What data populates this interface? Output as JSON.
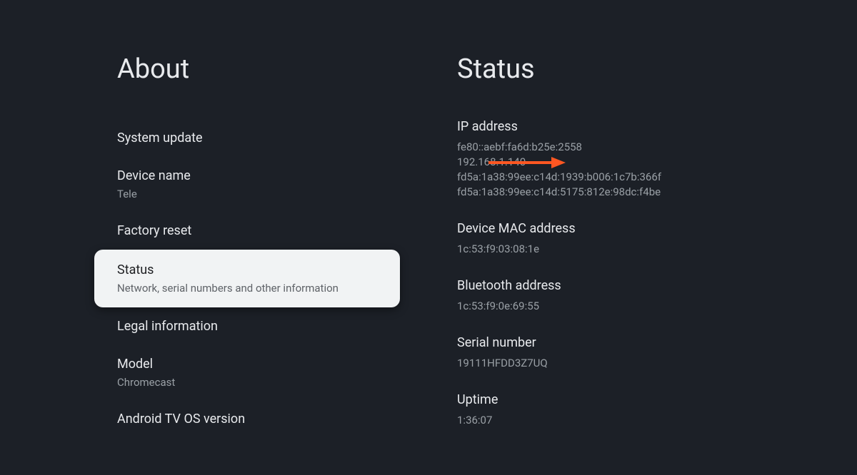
{
  "left": {
    "title": "About",
    "items": [
      {
        "title": "System update",
        "subtitle": ""
      },
      {
        "title": "Device name",
        "subtitle": "Tele"
      },
      {
        "title": "Factory reset",
        "subtitle": ""
      },
      {
        "title": "Status",
        "subtitle": "Network, serial numbers and other information",
        "selected": true
      },
      {
        "title": "Legal information",
        "subtitle": ""
      },
      {
        "title": "Model",
        "subtitle": "Chromecast"
      },
      {
        "title": "Android TV OS version",
        "subtitle": ""
      }
    ]
  },
  "right": {
    "title": "Status",
    "sections": [
      {
        "label": "IP address",
        "value": "fe80::aebf:fa6d:b25e:2558\n192.168.1.140\nfd5a:1a38:99ee:c14d:1939:b006:1c7b:366f\nfd5a:1a38:99ee:c14d:5175:812e:98dc:f4be"
      },
      {
        "label": "Device MAC address",
        "value": "1c:53:f9:03:08:1e"
      },
      {
        "label": "Bluetooth address",
        "value": "1c:53:f9:0e:69:55"
      },
      {
        "label": "Serial number",
        "value": "19111HFDD3Z7UQ"
      },
      {
        "label": "Uptime",
        "value": "1:36:07"
      }
    ]
  },
  "annotation": {
    "arrow_color": "#ff5722"
  }
}
